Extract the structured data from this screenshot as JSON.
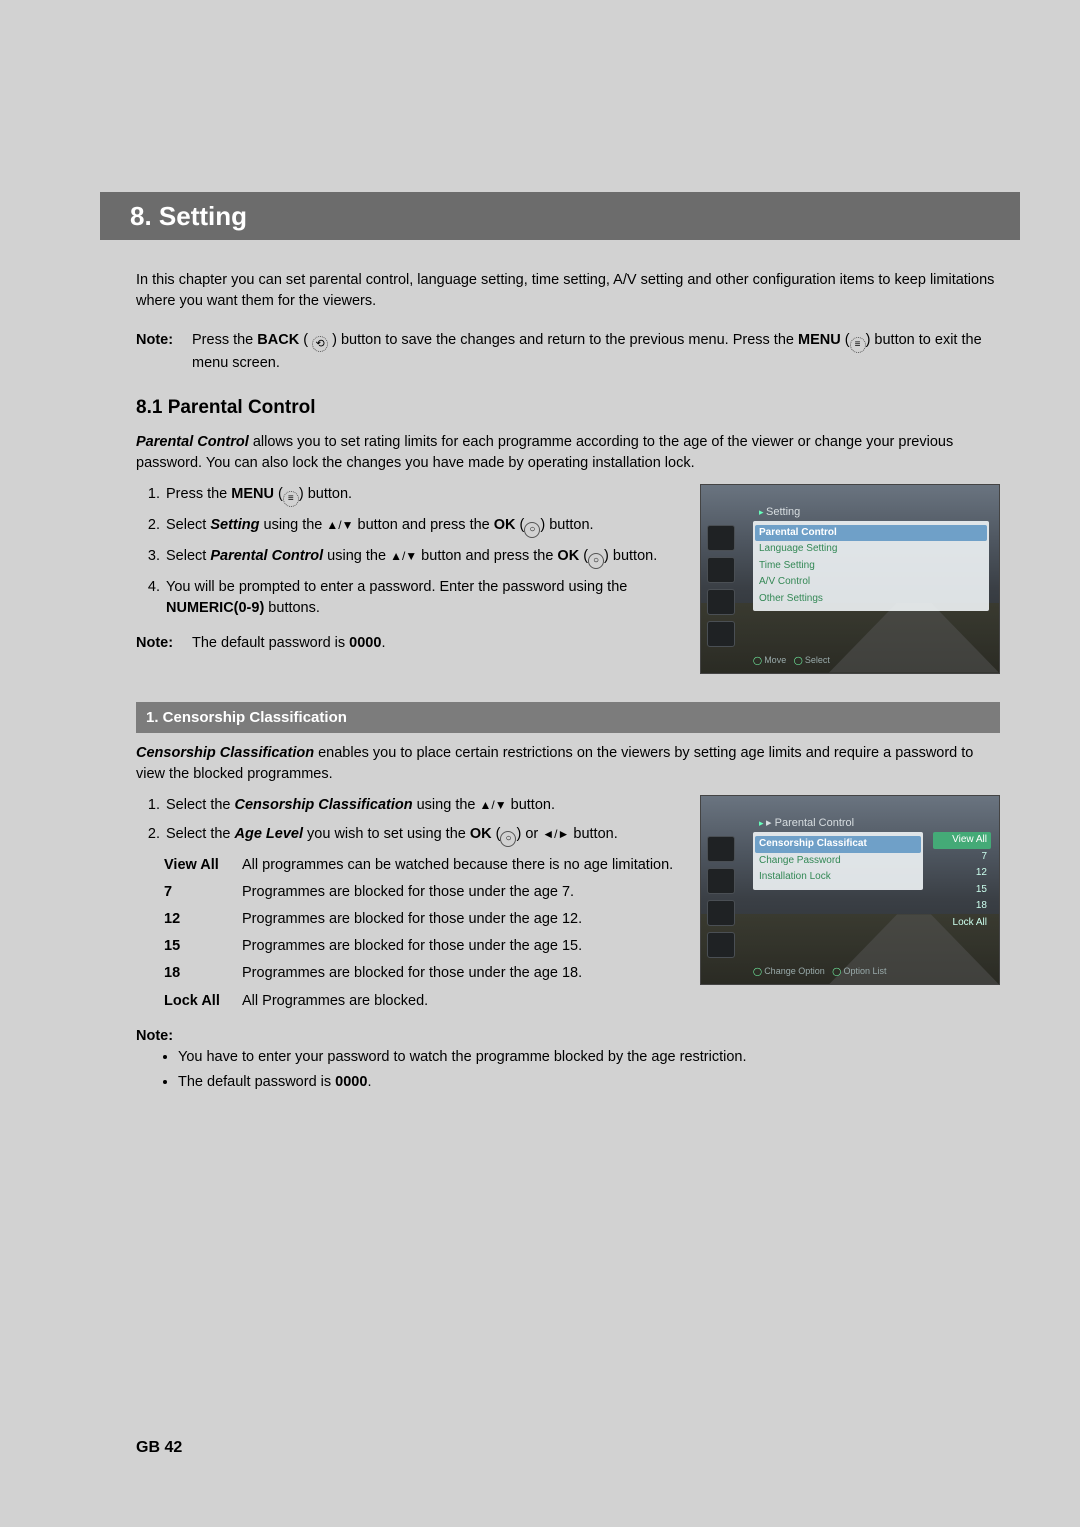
{
  "header": {
    "title": "8. Setting"
  },
  "intro": "In this chapter you can set parental control, language setting, time setting, A/V setting and other configuration items to keep limitations where you want them for the viewers.",
  "topNote": {
    "label": "Note:",
    "pre": "Press the ",
    "back": "BACK",
    "mid1": " button to save the changes and return to the previous menu. Press the ",
    "menu": "MENU",
    "post": " button to exit the menu screen."
  },
  "section81": {
    "heading": "8.1 Parental Control",
    "lead_bi": "Parental Control",
    "lead_rest": " allows you to set rating limits for each programme according to the age of the viewer or change your previous password. You can also lock the changes you have made by operating installation lock.",
    "steps": {
      "s1a": "Press the ",
      "s1b": "MENU",
      "s1c": " button.",
      "s2a": "Select ",
      "s2b": "Setting",
      "s2c": " using the ",
      "s2d": " button and press the ",
      "s2e": "OK",
      "s2f": " button.",
      "s3a": "Select ",
      "s3b": "Parental Control",
      "s3c": " using the ",
      "s3d": " button and press the ",
      "s3e": "OK",
      "s3f": " button.",
      "s4a": "You will be prompted to enter a password. Enter the password using the ",
      "s4b": "NUMERIC(0-9)",
      "s4c": " buttons."
    },
    "note2": {
      "label": "Note:",
      "a": "The default password is ",
      "b": "0000",
      "c": "."
    }
  },
  "osd1": {
    "title": "Setting",
    "items": [
      "Parental Control",
      "Language Setting",
      "Time Setting",
      "A/V Control",
      "Other Settings"
    ],
    "foot1": "Move",
    "foot2": "Select"
  },
  "sub1": {
    "bar": "1. Censorship Classification"
  },
  "cc": {
    "lead_bi": "Censorship Classification",
    "lead_rest": " enables you to place certain restrictions on the viewers by setting age limits and require a password to view the blocked programmes.",
    "s1a": "Select the ",
    "s1b": "Censorship Classification",
    "s1c": " using the ",
    "s1d": " button.",
    "s2a": "Select the ",
    "s2b": "Age Level",
    "s2c": " you wish to set using the ",
    "s2d": "OK",
    "s2e": " or ",
    "s2f": " button.",
    "defs": [
      {
        "k": "View All",
        "v": "All programmes can be watched because there is no age limitation."
      },
      {
        "k": "7",
        "v": "Programmes are blocked for those under the age 7."
      },
      {
        "k": "12",
        "v": "Programmes are blocked for those under the age 12."
      },
      {
        "k": "15",
        "v": "Programmes are blocked for those under the age 15."
      },
      {
        "k": "18",
        "v": "Programmes are blocked for those under the age 18."
      },
      {
        "k": "Lock All",
        "v": "All Programmes are blocked."
      }
    ],
    "noteLabel": "Note:",
    "bullets": {
      "b1": "You have to enter your password to watch the programme blocked by the age restriction.",
      "b2a": "The default password is ",
      "b2b": "0000",
      "b2c": "."
    }
  },
  "osd2": {
    "title": "Parental Control",
    "left": [
      "Censorship Classificat",
      "Change Password",
      "Installation Lock"
    ],
    "right": [
      "View All",
      "7",
      "12",
      "15",
      "18",
      "Lock All"
    ],
    "foot1": "Change Option",
    "foot2": "Option List"
  },
  "pageNum": "GB 42"
}
